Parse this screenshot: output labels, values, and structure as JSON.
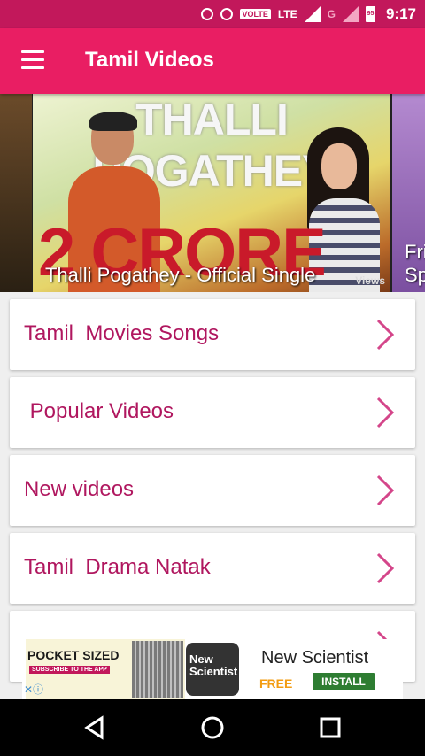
{
  "status_bar": {
    "volte_label": "VOLTE",
    "lte_label": "LTE",
    "network_label": "G",
    "battery_level": "95",
    "time": "9:17"
  },
  "app_bar": {
    "title": "Tamil Videos",
    "menu_icon": "hamburger-menu-icon"
  },
  "carousel": {
    "main_slide": {
      "image_headline": "THALLI POGATHEY",
      "image_big_text": "2 CRORE",
      "image_views_text": "Views",
      "caption": "Thalli Pogathey - Official Single"
    },
    "next_slide_caption_partial": [
      "Fri",
      "Sp"
    ]
  },
  "menu": {
    "items": [
      {
        "label": "Tamil  Movies Songs",
        "icon": "chevron-right-icon"
      },
      {
        "label": " Popular Videos",
        "icon": "chevron-right-icon"
      },
      {
        "label": "New videos",
        "icon": "chevron-right-icon"
      },
      {
        "label": "Tamil  Drama Natak",
        "icon": "chevron-right-icon"
      }
    ]
  },
  "ad": {
    "headline": "POCKET SIZED",
    "subline": "SUBSCRIBE TO THE APP",
    "logo_text": [
      "New",
      "Scientist"
    ],
    "app_name": "New Scientist",
    "price": "FREE",
    "install_label": "INSTALL"
  },
  "colors": {
    "status_bar": "#c2185b",
    "app_bar": "#e91e63",
    "menu_text": "#b0175f",
    "chevron": "#d4468a"
  }
}
